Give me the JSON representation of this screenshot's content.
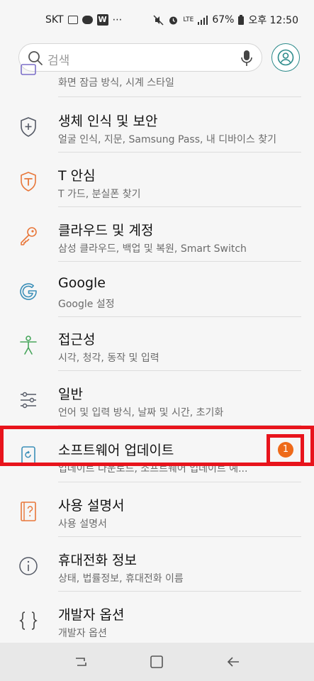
{
  "status_bar": {
    "carrier": "SKT",
    "network": "LTE",
    "battery": "67%",
    "time": "오후 12:50"
  },
  "search": {
    "placeholder": "검색"
  },
  "settings_items": [
    {
      "title": "",
      "subtitle": "화면 잠금 방식, 시계 스타일",
      "icon": "lock-screen-icon"
    },
    {
      "title": "생체 인식 및 보안",
      "subtitle": "얼굴 인식, 지문, Samsung Pass, 내 디바이스 찾기",
      "icon": "shield-icon"
    },
    {
      "title": "T 안심",
      "subtitle": "T 가드, 분실폰 찾기",
      "icon": "t-guard-icon"
    },
    {
      "title": "클라우드 및 계정",
      "subtitle": "삼성 클라우드, 백업 및 복원, Smart Switch",
      "icon": "key-icon"
    },
    {
      "title": "Google",
      "subtitle": "Google 설정",
      "icon": "google-icon"
    },
    {
      "title": "접근성",
      "subtitle": "시각, 청각, 동작 및 입력",
      "icon": "accessibility-icon"
    },
    {
      "title": "일반",
      "subtitle": "언어 및 입력 방식, 날짜 및 시간, 초기화",
      "icon": "sliders-icon"
    },
    {
      "title": "소프트웨어 업데이트",
      "subtitle": "업데이트 다운로드, 소프트웨어 업데이트 예...",
      "icon": "software-update-icon",
      "badge": "1"
    },
    {
      "title": "사용 설명서",
      "subtitle": "사용 설명서",
      "icon": "manual-icon"
    },
    {
      "title": "휴대전화 정보",
      "subtitle": "상태, 법률정보, 휴대전화 이름",
      "icon": "info-icon"
    },
    {
      "title": "개발자 옵션",
      "subtitle": "개발자 옵션",
      "icon": "braces-icon"
    }
  ],
  "colors": {
    "accent_teal": "#2b8a8a",
    "highlight_red": "#e8141c",
    "badge_orange": "#ee6a1a",
    "icon_blue": "#3b8fb8",
    "icon_orange": "#e8773a",
    "icon_green": "#48a65c"
  }
}
